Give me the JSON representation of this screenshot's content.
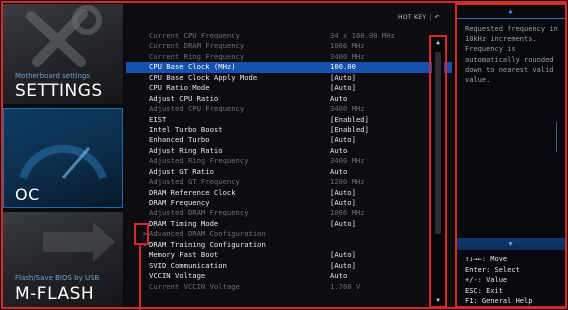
{
  "sidebar": {
    "settings": {
      "sub": "Motherboard settings",
      "title": "SETTINGS"
    },
    "oc": {
      "title": "OC"
    },
    "mflash": {
      "sub": "Flash/Save BIOS by USB",
      "title": "M-FLASH"
    }
  },
  "header": {
    "hotkey": "HOT KEY",
    "sep": "|",
    "back_icon": "↶"
  },
  "rows": [
    {
      "label": "Current CPU Frequency",
      "value": "34 x 100.00 MHz",
      "state": "dim"
    },
    {
      "label": "Current DRAM Frequency",
      "value": "1066 MHz",
      "state": "dim"
    },
    {
      "label": "Current Ring Frequency",
      "value": "3400 MHz",
      "state": "dim"
    },
    {
      "label": "CPU Base Clock (MHz)",
      "value": "100.00",
      "state": "sel"
    },
    {
      "label": "CPU Base Clock Apply Mode",
      "value": "[Auto]",
      "state": "norm"
    },
    {
      "label": "CPU Ratio Mode",
      "value": "[Auto]",
      "state": "norm"
    },
    {
      "label": "Adjust CPU Ratio",
      "value": "Auto",
      "state": "norm"
    },
    {
      "label": "Adjusted CPU Frequency",
      "value": "3400 MHz",
      "state": "dim"
    },
    {
      "label": "EIST",
      "value": "[Enabled]",
      "state": "norm"
    },
    {
      "label": "Intel Turbo Boost",
      "value": "[Enabled]",
      "state": "norm"
    },
    {
      "label": "Enhanced Turbo",
      "value": "[Auto]",
      "state": "norm"
    },
    {
      "label": "Adjust Ring Ratio",
      "value": "Auto",
      "state": "norm"
    },
    {
      "label": "Adjusted Ring Frequency",
      "value": "3400 MHz",
      "state": "dim"
    },
    {
      "label": "Adjust GT Ratio",
      "value": "Auto",
      "state": "norm"
    },
    {
      "label": "Adjusted GT Frequency",
      "value": "1200 MHz",
      "state": "dim"
    },
    {
      "label": "DRAM Reference Clock",
      "value": "[Auto]",
      "state": "norm"
    },
    {
      "label": "DRAM Frequency",
      "value": "[Auto]",
      "state": "norm"
    },
    {
      "label": "Adjusted DRAM Frequency",
      "value": "1066 MHz",
      "state": "dim"
    },
    {
      "label": "DRAM Timing Mode",
      "value": "[Auto]",
      "state": "norm"
    },
    {
      "label": "Advanced DRAM Configuration",
      "value": "",
      "state": "dim",
      "arrow": ">"
    },
    {
      "label": "DRAM Training Configuration",
      "value": "",
      "state": "norm",
      "arrow": ">"
    },
    {
      "label": "Memory Fast Boot",
      "value": "[Auto]",
      "state": "norm"
    },
    {
      "label": "SVID Communication",
      "value": "[Auto]",
      "state": "norm"
    },
    {
      "label": "VCCIN Voltage",
      "value": "Auto",
      "state": "norm"
    },
    {
      "label": "Current VCCIN Voltage",
      "value": "1.760 V",
      "state": "dim"
    }
  ],
  "help": {
    "text": "Requested frequency in 10kHz increments. Frequency is automatically rounded down to nearest valid value.",
    "keys": [
      "↑↓→←: Move",
      "Enter: Select",
      "+/-: Value",
      "ESC: Exit",
      "F1: General Help"
    ]
  }
}
